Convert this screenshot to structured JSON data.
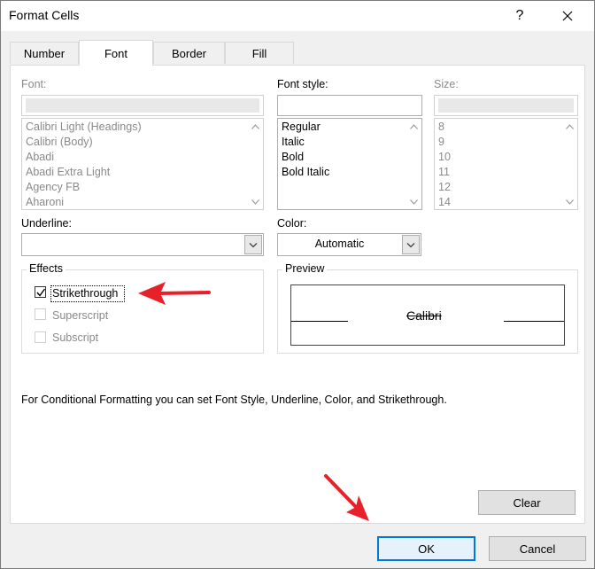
{
  "window": {
    "title": "Format Cells",
    "help_glyph": "?",
    "close_icon": "close-icon"
  },
  "tabs": [
    {
      "label": "Number"
    },
    {
      "label": "Font"
    },
    {
      "label": "Border"
    },
    {
      "label": "Fill"
    }
  ],
  "active_tab": "Font",
  "font": {
    "label": "Font:",
    "value": "",
    "options": [
      "Calibri Light (Headings)",
      "Calibri (Body)",
      "Abadi",
      "Abadi Extra Light",
      "Agency FB",
      "Aharoni"
    ]
  },
  "font_style": {
    "label": "Font style:",
    "value": "",
    "options": [
      "Regular",
      "Italic",
      "Bold",
      "Bold Italic"
    ]
  },
  "size": {
    "label": "Size:",
    "value": "",
    "options": [
      "8",
      "9",
      "10",
      "11",
      "12",
      "14"
    ]
  },
  "underline": {
    "label": "Underline:",
    "value": ""
  },
  "color": {
    "label": "Color:",
    "value": "Automatic"
  },
  "effects": {
    "label": "Effects",
    "strikethrough": {
      "label": "Strikethrough",
      "checked": true
    },
    "superscript": {
      "label": "Superscript",
      "checked": false
    },
    "subscript": {
      "label": "Subscript",
      "checked": false
    }
  },
  "preview": {
    "label": "Preview",
    "sample": "Calibri"
  },
  "info_text": "For Conditional Formatting you can set Font Style, Underline, Color, and Strikethrough.",
  "buttons": {
    "clear": "Clear",
    "ok": "OK",
    "cancel": "Cancel"
  },
  "colors": {
    "annotation_arrow": "#e8202a",
    "focus_border": "#0078d7"
  }
}
